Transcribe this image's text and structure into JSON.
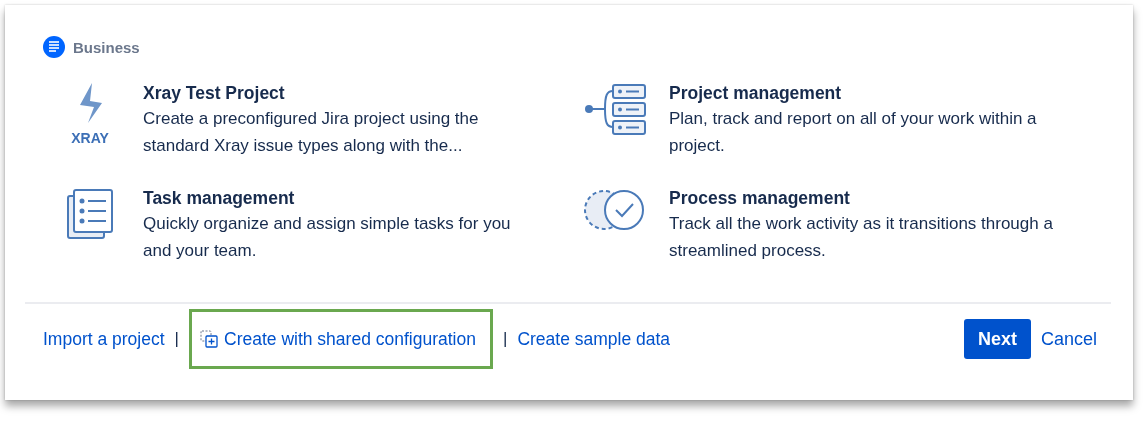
{
  "category": {
    "label": "Business"
  },
  "templates": [
    {
      "kind": "xray",
      "icon_label": "XRAY",
      "title": "Xray Test Project",
      "description": "Create a preconfigured Jira project using the standard Xray issue types along with the..."
    },
    {
      "kind": "project",
      "title": "Project management",
      "description": "Plan, track and report on all of your work within a project."
    },
    {
      "kind": "tasks",
      "title": "Task management",
      "description": "Quickly organize and assign simple tasks for you and your team."
    },
    {
      "kind": "process",
      "title": "Process management",
      "description": "Track all the work activity as it transitions through a streamlined process."
    }
  ],
  "footer": {
    "items": [
      {
        "kind": "link",
        "label": "Import a project",
        "highlighted": false
      },
      {
        "kind": "separator",
        "label": "|"
      },
      {
        "kind": "icon_link",
        "label": "Create with shared configuration",
        "highlighted": true
      },
      {
        "kind": "separator",
        "label": "|"
      },
      {
        "kind": "link",
        "label": "Create sample data",
        "highlighted": false
      }
    ],
    "buttons": [
      {
        "kind": "primary",
        "label": "Next"
      },
      {
        "kind": "link",
        "label": "Cancel"
      }
    ]
  }
}
